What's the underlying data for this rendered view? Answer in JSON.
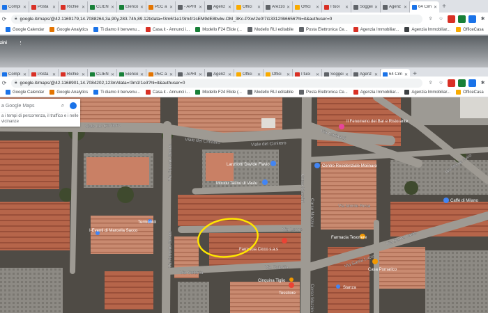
{
  "tabs_top": [
    {
      "label": "Compi",
      "color": "#1a73e8"
    },
    {
      "label": "Posta",
      "color": "#d93025"
    },
    {
      "label": "Richie",
      "color": "#d93025"
    },
    {
      "label": "CLIENT",
      "color": "#188038"
    },
    {
      "label": "Elenco",
      "color": "#188038"
    },
    {
      "label": "PEC a",
      "color": "#e37400"
    },
    {
      "label": "- APRI",
      "color": "#5f6368"
    },
    {
      "label": "Agenz",
      "color": "#5f6368"
    },
    {
      "label": "Offici",
      "color": "#f9ab00"
    },
    {
      "label": "Arezzo",
      "color": "#5f6368"
    },
    {
      "label": "Offici",
      "color": "#f9ab00"
    },
    {
      "label": "I tuoi",
      "color": "#d93025"
    },
    {
      "label": "Soggei",
      "color": "#5f6368"
    },
    {
      "label": "Agenz",
      "color": "#5f6368"
    },
    {
      "label": "64 Cim",
      "color": "#1a73e8",
      "active": true
    }
  ],
  "tabs_bottom": [
    {
      "label": "Compi",
      "color": "#1a73e8"
    },
    {
      "label": "Posta",
      "color": "#d93025"
    },
    {
      "label": "Richie",
      "color": "#d93025"
    },
    {
      "label": "CLIENT",
      "color": "#188038"
    },
    {
      "label": "Elenco",
      "color": "#188038"
    },
    {
      "label": "PEC a",
      "color": "#e37400"
    },
    {
      "label": "- APRI",
      "color": "#5f6368"
    },
    {
      "label": "Agenz",
      "color": "#5f6368"
    },
    {
      "label": "Offici",
      "color": "#f9ab00"
    },
    {
      "label": "Offici",
      "color": "#f9ab00"
    },
    {
      "label": "I tuoi",
      "color": "#d93025"
    },
    {
      "label": "Soggei",
      "color": "#5f6368"
    },
    {
      "label": "Agenz",
      "color": "#5f6368"
    },
    {
      "label": "64 Cim",
      "color": "#1a73e8",
      "active": true
    }
  ],
  "url_top": "google.it/maps/@42.1169179,14.7088264,3a,90y,283.74h,89.12t/data=!3m6!1e1!3m4!1sEM9dE8bvlw-OM_3Kc-PXw!2e0!7i13312!8i6656?hl=it&authuser=0",
  "url_bottom": "google.it/maps/@42.1168901,14.7084202,123m/data=!3m1!1e3?hl=it&authuser=0",
  "bookmarks_top": [
    {
      "label": "Google Calendar",
      "color": "#1a73e8"
    },
    {
      "label": "Google Analytics",
      "color": "#e37400"
    },
    {
      "label": "Ti diamo il benvenu...",
      "color": "#1a73e8"
    },
    {
      "label": "Casa.it - Annunci i...",
      "color": "#d93025"
    },
    {
      "label": "Modello F24 Elide (...",
      "color": "#188038"
    },
    {
      "label": "Modello RLI editabile",
      "color": "#5f6368"
    },
    {
      "label": "Posta Elettronica Ce...",
      "color": "#5f6368"
    },
    {
      "label": "Agenzia Immobiliar...",
      "color": "#d93025"
    },
    {
      "label": "Agenzia Immobiliar...",
      "color": "#3c4043"
    },
    {
      "label": "OfficeCasa",
      "color": "#f9ab00"
    }
  ],
  "bookmarks_bottom": [
    {
      "label": "Google Calendar",
      "color": "#1a73e8"
    },
    {
      "label": "Google Analytics",
      "color": "#e37400"
    },
    {
      "label": "Ti diamo il benvenu...",
      "color": "#1a73e8"
    },
    {
      "label": "Casa.it - Annunci i...",
      "color": "#d93025"
    },
    {
      "label": "Modello F24 Elide (...",
      "color": "#188038"
    },
    {
      "label": "Modello RLI editabile",
      "color": "#5f6368"
    },
    {
      "label": "Posta Elettronica Ce...",
      "color": "#5f6368"
    },
    {
      "label": "Agenzia Immobiliar...",
      "color": "#d93025"
    },
    {
      "label": "Agenzia Immobiliar...",
      "color": "#3c4043"
    },
    {
      "label": "OfficeCasa",
      "color": "#f9ab00"
    }
  ],
  "streetview_label": "zini",
  "search": {
    "placeholder": "a Google Maps",
    "hint": "a i tempi di percorrenza, il traffico e i nelle vicinanze"
  },
  "streets": {
    "s1": "Viale del Cimitero",
    "s2": "Viale del Cimitero",
    "s3": "Viale del Cimitero",
    "s4": "Via Antonio Bosco",
    "s5": "Via Antonio Bosco",
    "s6": "Corso Mazzini",
    "s7": "Corso Mazzini",
    "s8": "Corso Mazzini",
    "s9": "Via Lecce",
    "s10": "Via Catania",
    "s11": "Via Catania",
    "s12": "Via Monte Rosa",
    "s13": "Via Santa Lucia",
    "s14": "Via Santa Lucia",
    "s15": "Via Garibaldi",
    "s16": "Via Monte Nero",
    "s17": "Via Antonio Bosco"
  },
  "pois": {
    "p1": "Lanzilotti Davide Flavio",
    "p2": "Mondo Tattoo di Vasto",
    "p3": "Centro Residenziale Molinaro",
    "p4": "Il Fenomeno del Bar e Ristorante",
    "p5": "Farmacia Tesoriere",
    "p6": "Casa Pomarico",
    "p7": "Tessitore",
    "p8": "Farmacia Cicco s.a.s",
    "p9": "Termonidi",
    "p10": "Cinquina Tiglio",
    "p11": "Caffè di Milano",
    "p12": "I-Eventi di Marcella Sacco",
    "p13": "Stanza"
  },
  "colors": {
    "annotation": "#ffe600",
    "pin_blue": "#4285f4",
    "pin_red": "#ea4335",
    "pin_orange": "#f29900",
    "pin_pink": "#e8459b"
  }
}
